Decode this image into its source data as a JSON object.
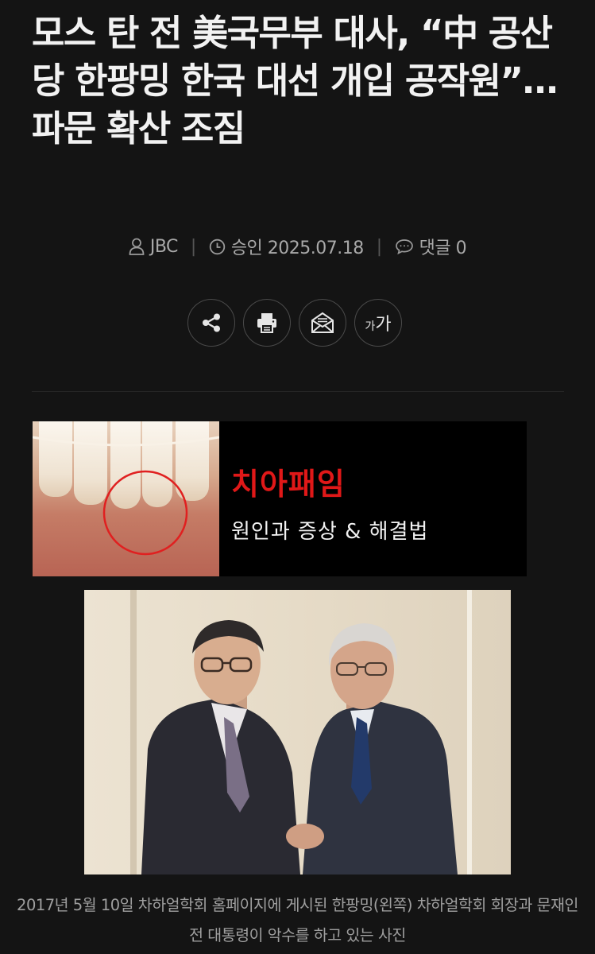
{
  "article": {
    "headline": "모스 탄 전 美국무부 대사, “中 공산당 한팡밍 한국 대선 개입 공작원”…파문 확산 조짐",
    "author": "JBC",
    "approved": "승인 2025.07.18",
    "comments": "댓글 0",
    "caption": "2017년 5월 10일 차하얼학회 홈페이지에 게시된 한팡밍(왼쪽) 차하얼학회 회장과 문재인 전 대통령이 악수를 하고 있는 사진"
  },
  "actions": {
    "font_size_big": "가",
    "font_size_small": "가"
  },
  "ad": {
    "headline": "치아패임",
    "subline": "원인과 증상 & 해결법",
    "accent": "#e01818"
  },
  "icons": [
    "user-icon",
    "clock-icon",
    "comment-icon",
    "share-icon",
    "print-icon",
    "mail-icon",
    "font-size-icon"
  ]
}
